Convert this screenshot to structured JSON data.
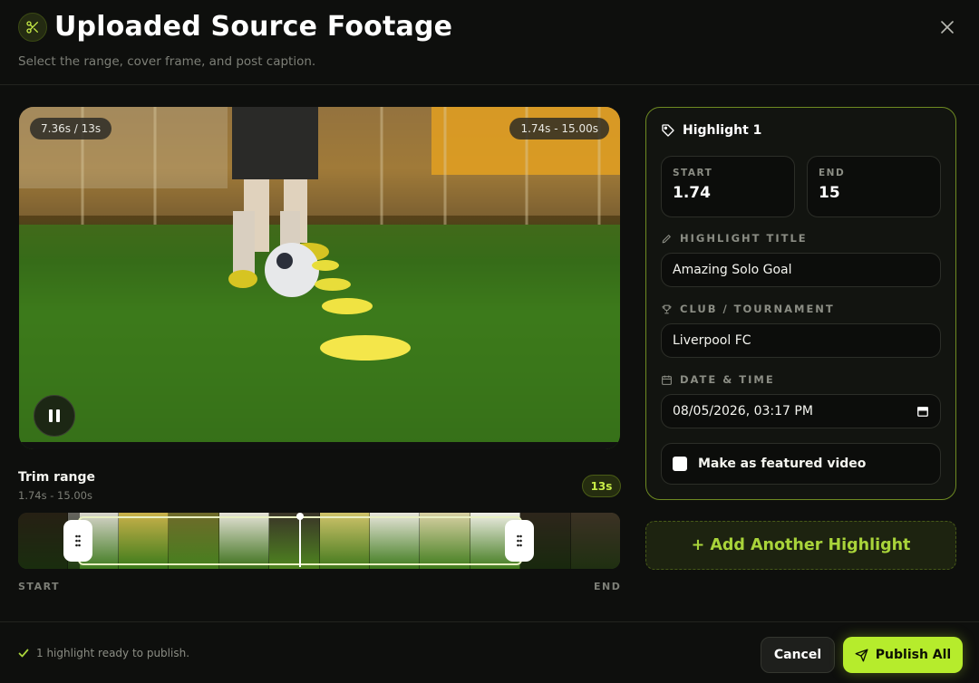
{
  "header": {
    "title": "Uploaded Source Footage",
    "subtitle": "Select the range, cover frame, and post caption.",
    "icon": "scissors-icon"
  },
  "video": {
    "current_time": "7.36s / 13s",
    "range": "1.74s - 15.00s",
    "playback_state": "playing"
  },
  "trim": {
    "label": "Trim range",
    "range_text": "1.74s - 15.00s",
    "duration_badge": "13s",
    "start_label": "START",
    "end_label": "END",
    "playhead_fraction": 0.5
  },
  "highlight": {
    "title": "Highlight 1",
    "start_label": "START",
    "start_value": "1.74",
    "end_label": "END",
    "end_value": "15",
    "title_field_label": "HIGHLIGHT TITLE",
    "title_value": "Amazing Solo Goal",
    "club_label": "CLUB / TOURNAMENT",
    "club_value": "Liverpool FC",
    "date_label": "DATE & TIME",
    "date_value": "08/05/2026, 03:17 PM",
    "featured_label": "Make as featured video",
    "featured_checked": false
  },
  "actions": {
    "add_highlight": "+ Add Another Highlight",
    "cancel": "Cancel",
    "publish": "Publish All"
  },
  "footer": {
    "status": "1 highlight ready to publish."
  },
  "colors": {
    "accent": "#b6ec2c",
    "panel_border": "#6e8a22",
    "background": "#0e0f0d"
  }
}
